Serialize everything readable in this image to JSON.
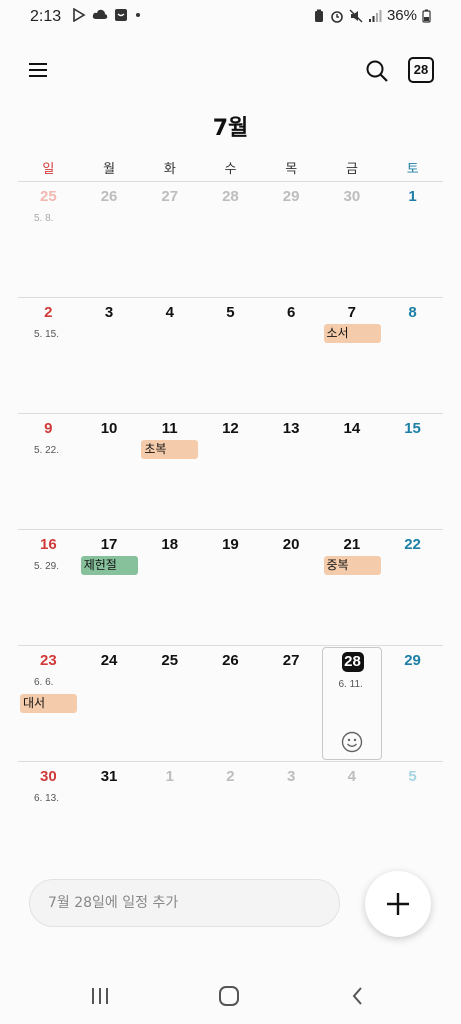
{
  "status_bar": {
    "time": "2:13",
    "battery": "36%",
    "left_icons": [
      "play-store-icon",
      "cloud-icon",
      "app-icon",
      "dot-icon"
    ],
    "right_icons": [
      "battery-saver-icon",
      "alarm-icon",
      "mute-icon",
      "signal-icon",
      "battery-icon"
    ]
  },
  "header": {
    "title": "7월",
    "today_badge": "28"
  },
  "weekdays": [
    "일",
    "월",
    "화",
    "수",
    "목",
    "금",
    "토"
  ],
  "weeks": [
    {
      "days": [
        {
          "num": "25",
          "lunar": "5. 8.",
          "muted": true
        },
        {
          "num": "26",
          "muted": true
        },
        {
          "num": "27",
          "muted": true
        },
        {
          "num": "28",
          "muted": true
        },
        {
          "num": "29",
          "muted": true
        },
        {
          "num": "30",
          "muted": true
        },
        {
          "num": "1"
        }
      ]
    },
    {
      "days": [
        {
          "num": "2",
          "lunar": "5. 15."
        },
        {
          "num": "3"
        },
        {
          "num": "4"
        },
        {
          "num": "5"
        },
        {
          "num": "6"
        },
        {
          "num": "7",
          "event": "소서",
          "event_color": "peach"
        },
        {
          "num": "8"
        }
      ]
    },
    {
      "days": [
        {
          "num": "9",
          "lunar": "5. 22."
        },
        {
          "num": "10"
        },
        {
          "num": "11",
          "event": "초복",
          "event_color": "peach"
        },
        {
          "num": "12"
        },
        {
          "num": "13"
        },
        {
          "num": "14"
        },
        {
          "num": "15"
        }
      ]
    },
    {
      "days": [
        {
          "num": "16",
          "lunar": "5. 29."
        },
        {
          "num": "17",
          "event": "제헌절",
          "event_color": "green"
        },
        {
          "num": "18"
        },
        {
          "num": "19"
        },
        {
          "num": "20"
        },
        {
          "num": "21",
          "event": "중복",
          "event_color": "peach"
        },
        {
          "num": "22"
        }
      ]
    },
    {
      "days": [
        {
          "num": "23",
          "lunar": "6. 6.",
          "event": "대서",
          "event_color": "peach"
        },
        {
          "num": "24"
        },
        {
          "num": "25"
        },
        {
          "num": "26"
        },
        {
          "num": "27"
        },
        {
          "num": "28",
          "lunar": "6. 11.",
          "today": true
        },
        {
          "num": "29"
        }
      ]
    },
    {
      "days": [
        {
          "num": "30",
          "lunar": "6. 13."
        },
        {
          "num": "31"
        },
        {
          "num": "1",
          "muted": true
        },
        {
          "num": "2",
          "muted": true
        },
        {
          "num": "3",
          "muted": true
        },
        {
          "num": "4",
          "muted": true
        },
        {
          "num": "5",
          "muted": true
        }
      ]
    }
  ],
  "add_event": {
    "placeholder": "7월 28일에 일정 추가"
  },
  "colors": {
    "sunday": "#d23a3a",
    "saturday": "#1d7fa6",
    "event_peach": "#f5ccab",
    "event_green": "#86c19c"
  }
}
